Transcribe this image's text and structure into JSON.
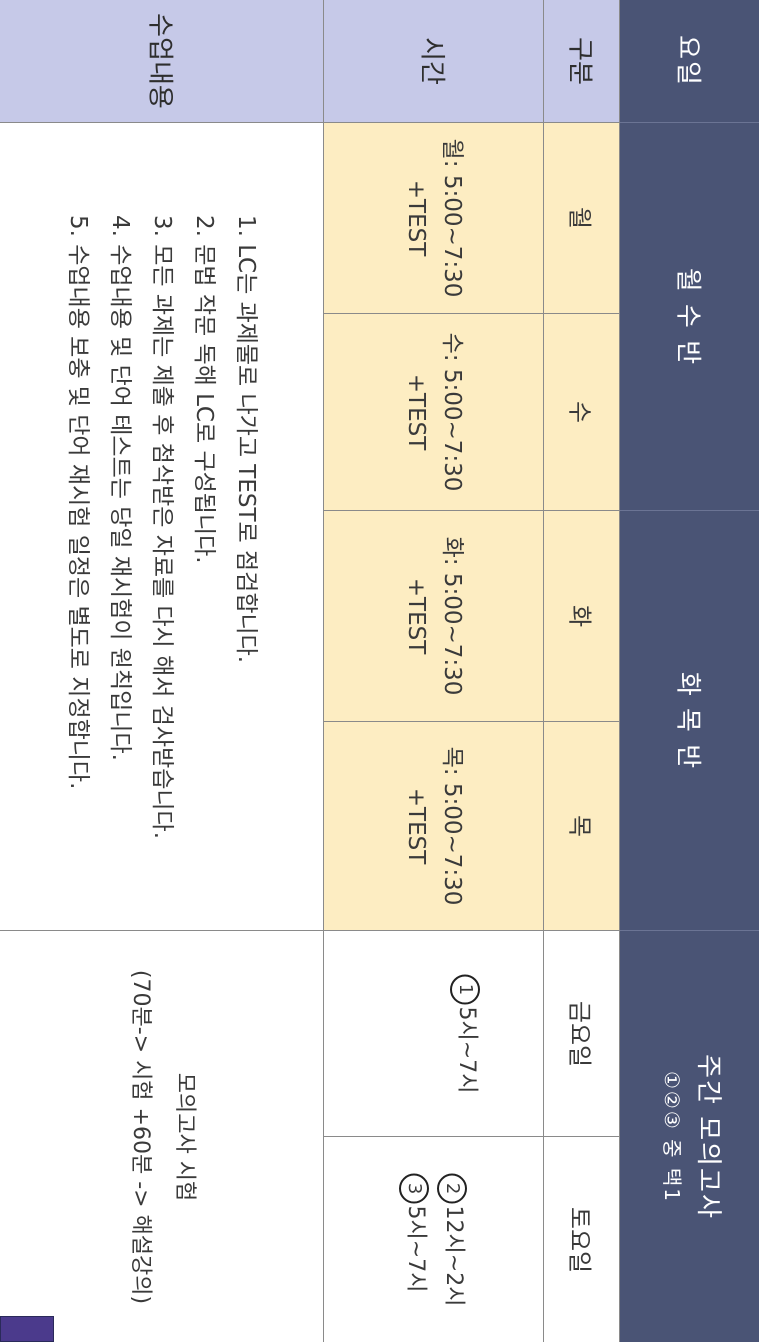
{
  "headers": {
    "day": "요일",
    "gubun": "구분",
    "time": "시간",
    "content": "수업내용"
  },
  "groups": {
    "mon_wed": "월 수 반",
    "tue_thu": "화 목 반",
    "weekly_mock_title": "주간 모의고사",
    "weekly_mock_choice": "①②③ 중 택1"
  },
  "days": {
    "mon": "월",
    "wed": "수",
    "tue": "화",
    "thu": "목",
    "fri": "금요일",
    "sat": "토요일"
  },
  "times": {
    "mon": "월: 5:00~7:30",
    "wed": "수: 5:00~7:30",
    "tue": "화: 5:00~7:30",
    "thu": "목: 5:00~7:30",
    "test": "+TEST",
    "fri_slot_num": "1",
    "fri_slot": "5시~7시",
    "sat_slot2_num": "2",
    "sat_slot2": "12시~2시",
    "sat_slot3_num": "3",
    "sat_slot3": "5시~7시"
  },
  "notes": [
    "1. LC는 과제물로 나가고 TEST로 점검합니다.",
    "2. 문법 작문 독해 LC로 구성됩니다.",
    "3. 모든 과제는 제출 후 첨삭받은 자료를 다시 해서 검사받습니다.",
    "4. 수업내용 및 단어 테스트는 당일 재시험이 원칙입니다.",
    "5. 수업내용 보충 및 단어 재시험 일정은 별도로 지정합니다."
  ],
  "mock_exam": {
    "title": "모의고사 시험",
    "flow": "(70분-> 시험 +60분 -> 해설강의)"
  },
  "colors": {
    "dark_header": "#4a5475",
    "light_header": "#c6c9e8",
    "yellow_cell": "#fdedc2"
  }
}
